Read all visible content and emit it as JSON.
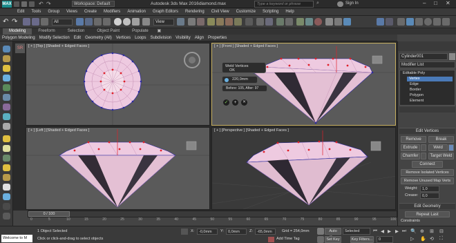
{
  "title": {
    "workspace": "Workspace: Default",
    "app": "Autodesk 3ds Max 2016",
    "file": "diamond.max",
    "search_placeholder": "Type a keyword or phrase",
    "sign_in": "Sign In",
    "logo": "MAX"
  },
  "menu": [
    "Edit",
    "Tools",
    "Group",
    "Views",
    "Create",
    "Modifiers",
    "Animation",
    "Graph Editors",
    "Rendering",
    "Civil View",
    "Customize",
    "Scripting",
    "Help"
  ],
  "toolbar": {
    "filter": "All",
    "view": "View"
  },
  "ribbon": {
    "tabs": [
      "Modeling",
      "Freeform",
      "Selection",
      "Object Paint",
      "Populate"
    ]
  },
  "subribbon": [
    "Polygon Modeling",
    "Modify Selection",
    "Edit",
    "Geometry (All)",
    "Vertices",
    "Loops",
    "Subdivision",
    "Visibility",
    "Align",
    "Properties"
  ],
  "viewports": {
    "top": "[ + ] [Top ] [Shaded + Edged Faces ]",
    "front": "[ + ] [Front ] [Shaded + Edged Faces ]",
    "left": "[ + ] [Left ] [Shaded + Edged Faces ]",
    "perspective": "[ + ] [Perspective ] [Shaded + Edged Faces ]"
  },
  "weld": {
    "title": "Weld Vertices",
    "ok": "OK",
    "threshold": "220,0mm",
    "result": "Before: 105, After: 97"
  },
  "command_panel": {
    "object_name": "Cylinder001",
    "modifier_list": "Modifier List",
    "stack": [
      "Editable Poly",
      "Vertex",
      "Edge",
      "Border",
      "Polygon",
      "Element"
    ],
    "edit_vertices_title": "Edit Vertices",
    "buttons": {
      "remove": "Remove",
      "break": "Break",
      "extrude": "Extrude",
      "weld": "Weld",
      "chamfer": "Chamfer",
      "target_weld": "Target Weld",
      "connect": "Connect",
      "remove_isolated": "Remove Isolated Vertices",
      "remove_unused": "Remove Unused Map Verts"
    },
    "weight_label": "Weight:",
    "weight_value": "1,0",
    "crease_label": "Crease:",
    "crease_value": "0,0",
    "edit_geometry_title": "Edit Geometry",
    "repeat_last": "Repeat Last",
    "constraints": "Constraints"
  },
  "timeline": {
    "frame": "0 / 100",
    "ticks": [
      "0",
      "5",
      "10",
      "15",
      "20",
      "25",
      "30",
      "35",
      "40",
      "45",
      "50",
      "55",
      "60",
      "65",
      "70",
      "75",
      "80",
      "85",
      "90",
      "95",
      "100"
    ]
  },
  "status": {
    "maxscript": "Welcome to M",
    "selected": "1 Object Selected",
    "hint": "Click or click-and-drag to select objects",
    "x": "-0,0mm",
    "y": "0,0mm",
    "z": "-65,0mm",
    "grid": "Grid = 254,0mm",
    "time_tag": "Add Time Tag",
    "auto_key": "Auto Key",
    "selected_dd": "Selected",
    "set_key": "Set Key",
    "key_filters": "Key Filters...",
    "frame_field": "0"
  },
  "colors": {
    "accent": "#1b8c8c",
    "gem_face": "#eecae0",
    "vertex": "#e0202a",
    "edge_vertex": "#2a2aa0",
    "active_border": "#c8b060"
  }
}
